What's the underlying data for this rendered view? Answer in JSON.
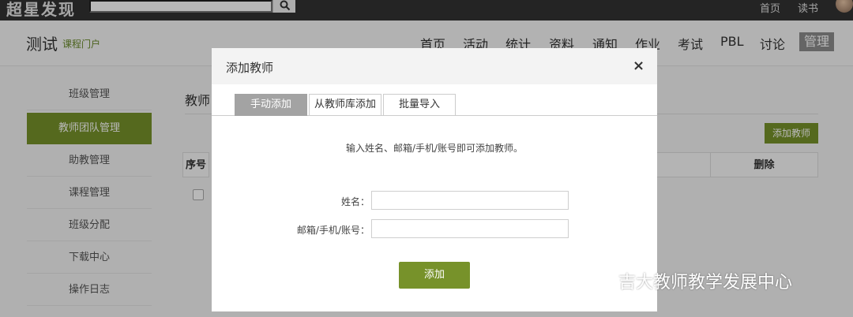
{
  "topbar": {
    "logo": "超星发现",
    "search_placeholder": "",
    "links": [
      "首页",
      "读书"
    ]
  },
  "header": {
    "course_title": "测试",
    "course_sub": "课程门户",
    "nav": [
      "首页",
      "活动",
      "统计",
      "资料",
      "通知",
      "作业",
      "考试",
      "PBL",
      "讨论"
    ],
    "nav_active": "管理"
  },
  "sidebar": {
    "items": [
      "班级管理",
      "教师团队管理",
      "助教管理",
      "课程管理",
      "班级分配",
      "下载中心",
      "操作日志"
    ],
    "active_index": 1
  },
  "main": {
    "title": "教师",
    "add_button": "添加教师",
    "table_headers": {
      "index": "序号",
      "delete": "删除"
    }
  },
  "modal": {
    "title": "添加教师",
    "close": "×",
    "tabs": [
      "手动添加",
      "从教师库添加",
      "批量导入"
    ],
    "active_tab": 0,
    "hint": "输入姓名、邮箱/手机/账号即可添加教师。",
    "name_label": "姓名：",
    "name_value": "",
    "account_label": "邮箱/手机/账号：",
    "account_value": "",
    "submit": "添加"
  },
  "watermark": {
    "text": "吉大教师教学发展中心"
  },
  "colors": {
    "accent": "#77922a",
    "topbar": "#333333",
    "tab_active": "#a3a3a3"
  }
}
